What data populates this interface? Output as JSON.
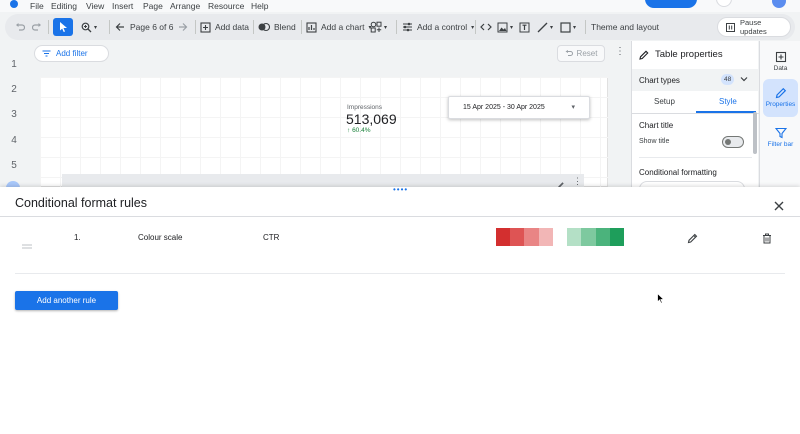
{
  "menu": [
    "File",
    "Editing",
    "View",
    "Insert",
    "Page",
    "Arrange",
    "Resource",
    "Help"
  ],
  "toolbar": {
    "page_nav": "Page 6 of 6",
    "add_data": "Add data",
    "blend": "Blend",
    "add_chart": "Add a chart",
    "add_control": "Add a control",
    "theme": "Theme and layout",
    "pause": "Pause updates"
  },
  "row_numbers": [
    "1",
    "2",
    "3",
    "4",
    "5"
  ],
  "canvas": {
    "add_filter": "Add filter",
    "reset": "Reset",
    "kpi": {
      "label": "Impressions",
      "value": "513,069",
      "delta": "60.4%"
    },
    "date_range": "15 Apr 2025 - 30 Apr 2025"
  },
  "properties": {
    "title": "Table properties",
    "chart_types": "Chart types",
    "chart_types_count": "48",
    "tabs": [
      "Setup",
      "Style"
    ],
    "active_tab": "Style",
    "chart_title_heading": "Chart title",
    "show_title": "Show title",
    "cond_heading": "Conditional formatting"
  },
  "sidebar": {
    "data": "Data",
    "properties": "Properties",
    "filter_bar": "Filter bar"
  },
  "modal": {
    "title": "Conditional format rules",
    "rules": [
      {
        "number": "1.",
        "type": "Colour scale",
        "field": "CTR"
      }
    ],
    "add_rule": "Add another rule"
  },
  "colors": {
    "accent": "#1a73e8",
    "scale": [
      "#d32f2f",
      "#de5454",
      "#e98585",
      "#f2b6b6",
      "#ffffff",
      "#b4e0c6",
      "#7ec99f",
      "#4bb37c",
      "#1e9e5b"
    ]
  }
}
